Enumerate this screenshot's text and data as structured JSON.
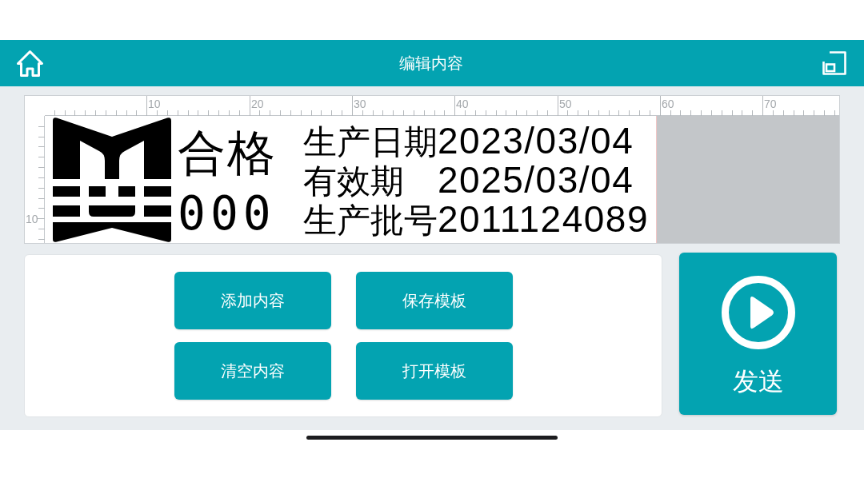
{
  "header": {
    "title": "编辑内容"
  },
  "ruler": {
    "top_labels": [
      "10",
      "20",
      "30",
      "40",
      "50",
      "60",
      "70"
    ],
    "left_labels": [
      "10"
    ]
  },
  "preview": {
    "dot_text": [
      "合格",
      "000"
    ],
    "lines": [
      {
        "label": "生产日期",
        "value": "2023/03/04"
      },
      {
        "label": "有效期",
        "value": "2025/03/04"
      },
      {
        "label": "生产批号",
        "value": "2011124089"
      }
    ]
  },
  "actions": [
    {
      "label": "添加内容"
    },
    {
      "label": "保存模板"
    },
    {
      "label": "清空内容"
    },
    {
      "label": "打开模板"
    }
  ],
  "send_button": {
    "label": "发送"
  }
}
